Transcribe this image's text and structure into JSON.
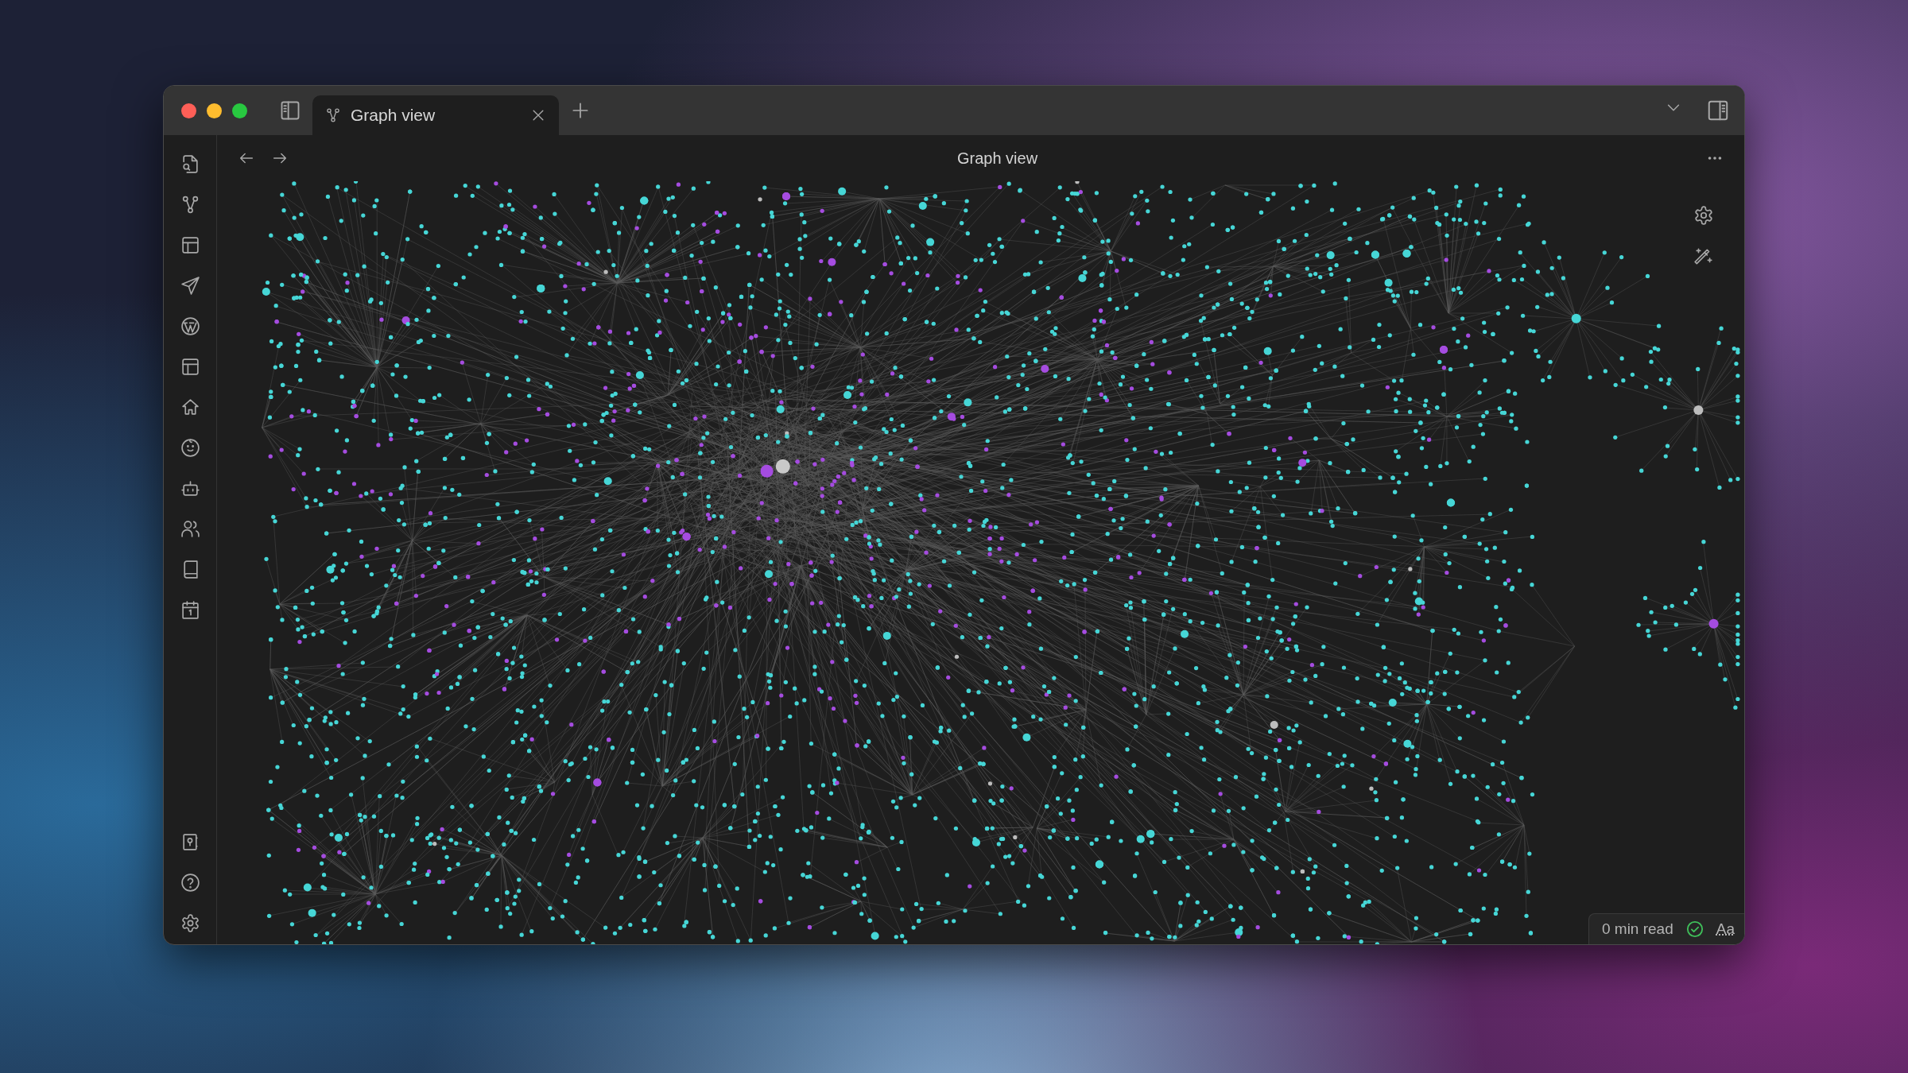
{
  "tabs": [
    {
      "label": "Graph view",
      "selected": true
    }
  ],
  "header": {
    "title": "Graph view"
  },
  "status_bar": {
    "reading_time": "0 min read",
    "font_button": "Aa"
  }
}
